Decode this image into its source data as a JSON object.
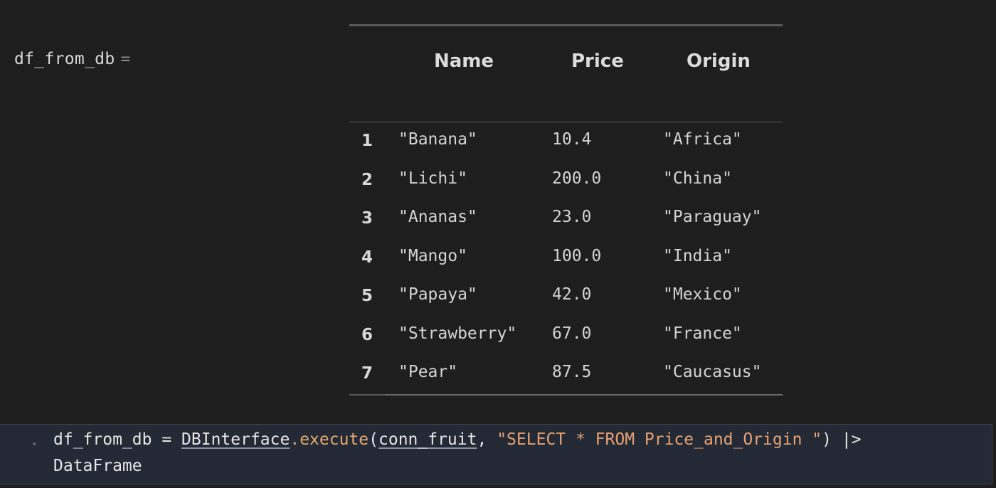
{
  "output": {
    "variable": "df_from_db",
    "equals": "="
  },
  "table": {
    "headers": [
      "Name",
      "Price",
      "Origin"
    ],
    "rows": [
      {
        "index": "1",
        "name": "\"Banana\"",
        "price": "10.4",
        "origin": "\"Africa\""
      },
      {
        "index": "2",
        "name": "\"Lichi\"",
        "price": "200.0",
        "origin": "\"China\""
      },
      {
        "index": "3",
        "name": "\"Ananas\"",
        "price": "23.0",
        "origin": "\"Paraguay\""
      },
      {
        "index": "4",
        "name": "\"Mango\"",
        "price": "100.0",
        "origin": "\"India\""
      },
      {
        "index": "5",
        "name": "\"Papaya\"",
        "price": "42.0",
        "origin": "\"Mexico\""
      },
      {
        "index": "6",
        "name": "\"Strawberry\"",
        "price": "67.0",
        "origin": "\"France\""
      },
      {
        "index": "7",
        "name": "\"Pear\"",
        "price": "87.5",
        "origin": "\"Caucasus\""
      }
    ]
  },
  "code": {
    "bullet": "•",
    "line1": {
      "var": "df_from_db",
      "assign": " = ",
      "module": "DBInterface",
      "dot_fn": ".execute",
      "open": "(",
      "arg1": "conn_fruit",
      "comma": ", ",
      "query": "\"SELECT * FROM Price_and_Origin \"",
      "close": ")",
      "pipe": " |>"
    },
    "line2": "DataFrame"
  },
  "colors": {
    "background": "#1e1e1e",
    "code_cell_bg": "#232a36",
    "function_accent": "#e6a86e"
  }
}
